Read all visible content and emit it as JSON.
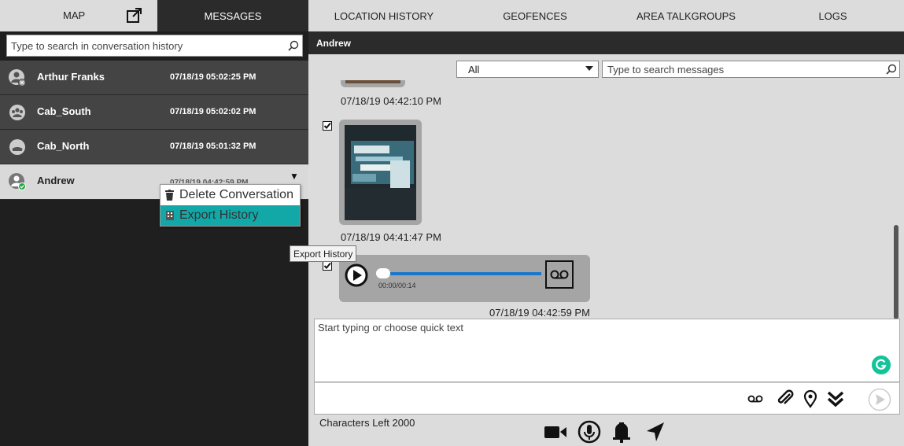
{
  "tabs": {
    "map": "MAP",
    "messages": "MESSAGES",
    "location_history": "LOCATION HISTORY",
    "geofences": "GEOFENCES",
    "area_talkgroups": "AREA TALKGROUPS",
    "logs": "LOGS"
  },
  "conversation_search": {
    "placeholder": "Type to search in conversation history"
  },
  "conversations": [
    {
      "name": "Arthur Franks",
      "time": "07/18/19 05:02:25 PM",
      "status": "offline"
    },
    {
      "name": "Cab_South",
      "time": "07/18/19 05:02:02 PM",
      "status": "group"
    },
    {
      "name": "Cab_North",
      "time": "07/18/19 05:01:32 PM",
      "status": "group"
    },
    {
      "name": "Andrew",
      "time": "07/18/19 04:42:59 PM",
      "status": "online"
    }
  ],
  "context_menu": {
    "delete": "Delete Conversation",
    "export": "Export History"
  },
  "tooltip": "Export History",
  "conversation_header": {
    "title": "Andrew"
  },
  "message_filter": {
    "selected": "All"
  },
  "message_search": {
    "placeholder": "Type to search messages"
  },
  "messages": [
    {
      "type": "image",
      "timestamp": "07/18/19 04:42:10 PM"
    },
    {
      "type": "image",
      "timestamp": "07/18/19 04:41:47 PM"
    },
    {
      "type": "audio",
      "duration": "00:00/00:14",
      "timestamp": "07/18/19 04:42:59 PM"
    }
  ],
  "compose": {
    "placeholder": "Start typing or choose quick text",
    "characters_left": "Characters Left 2000"
  },
  "colors": {
    "dark_bar": "#2b2b2b",
    "list_item": "#444444",
    "accent_teal": "#13a8a8",
    "audio_track": "#1a77c9",
    "grammarly_green": "#15c39a"
  }
}
